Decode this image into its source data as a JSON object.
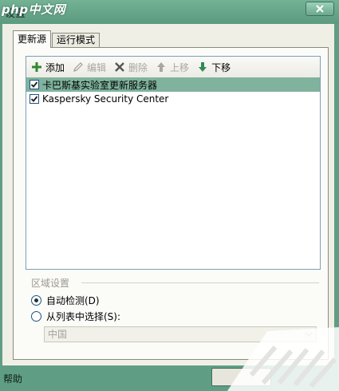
{
  "window": {
    "title": "设置",
    "watermark": "php中文网"
  },
  "tabs": [
    {
      "label": "更新源",
      "active": true
    },
    {
      "label": "运行模式",
      "active": false
    }
  ],
  "toolbar": {
    "add": "添加",
    "edit": "编辑",
    "delete": "删除",
    "move_up": "上移",
    "move_down": "下移"
  },
  "sources": [
    {
      "label": "卡巴斯基实验室更新服务器",
      "checked": true,
      "selected": true
    },
    {
      "label": "Kaspersky Security Center",
      "checked": true,
      "selected": false
    }
  ],
  "region": {
    "title": "区域设置",
    "auto_detect": "自动检测(D)",
    "select_from_list": "从列表中选择(S):",
    "selected_value": "中国"
  },
  "footer": {
    "help": "帮助"
  },
  "colors": {
    "frame": "#5f9e84",
    "selection": "#7fb39e",
    "panel": "#fbfbf8"
  }
}
